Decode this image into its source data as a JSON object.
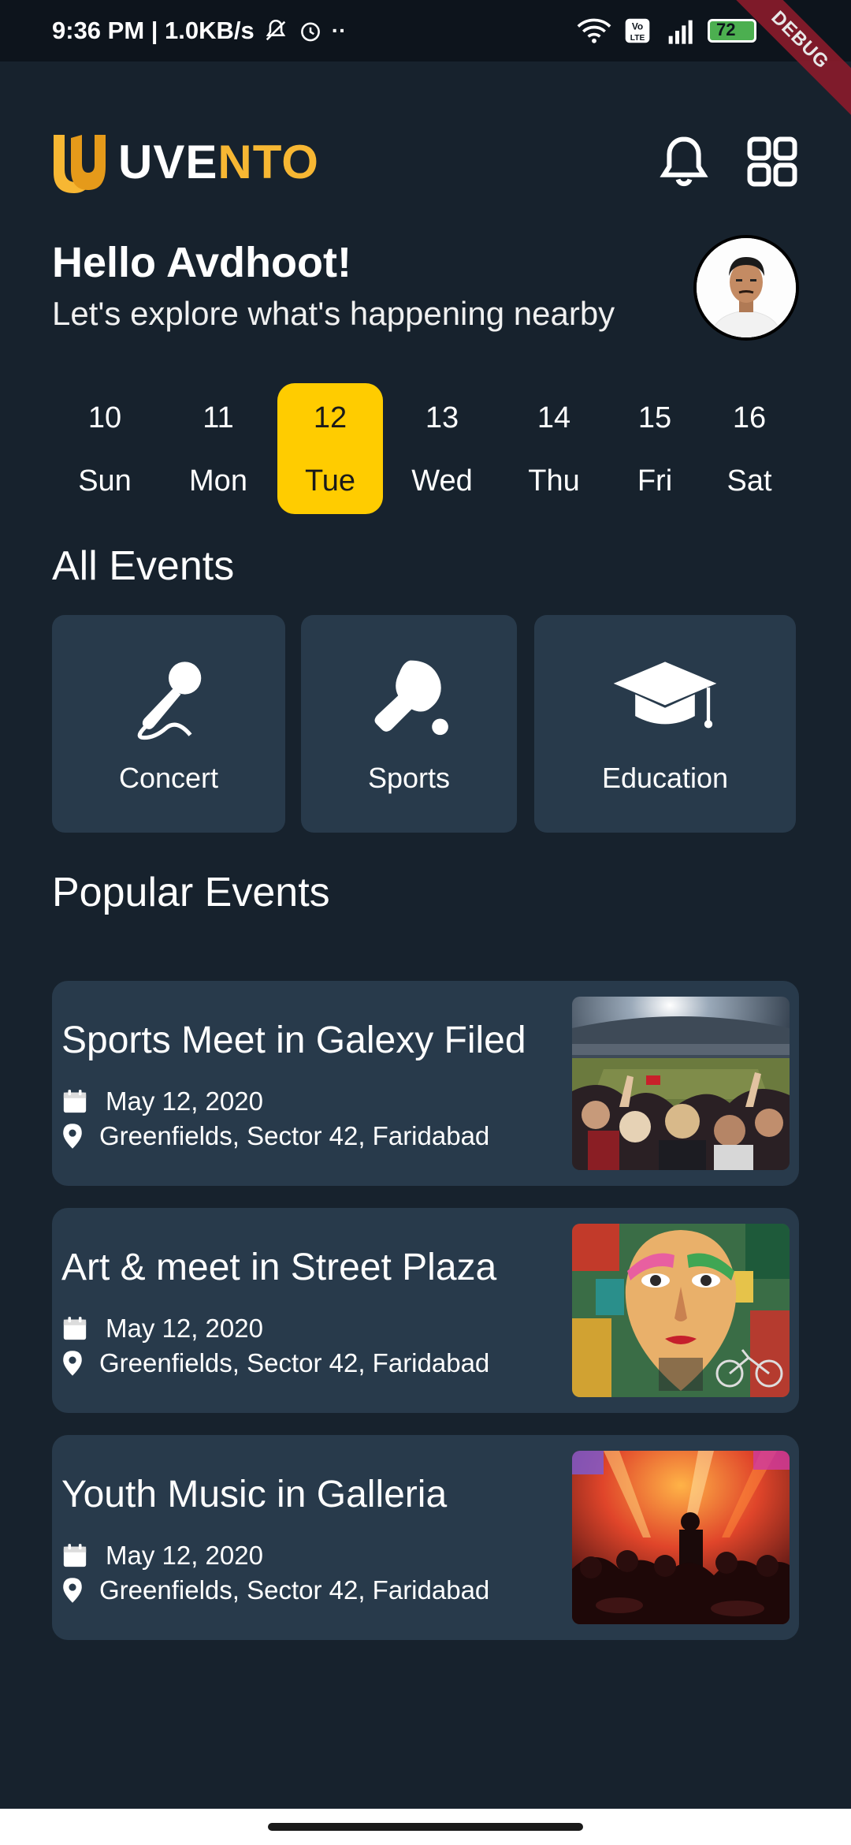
{
  "status_bar": {
    "time_speed": "9:36 PM | 1.0KB/s",
    "battery": "72",
    "debug": "DEBUG"
  },
  "header": {
    "logo_white": "UVE",
    "logo_yellow": "NTO"
  },
  "greeting": {
    "title": "Hello Avdhoot!",
    "subtitle": "Let's explore what's happening nearby"
  },
  "dates": [
    {
      "num": "10",
      "day": "Sun",
      "active": false
    },
    {
      "num": "11",
      "day": "Mon",
      "active": false
    },
    {
      "num": "12",
      "day": "Tue",
      "active": true
    },
    {
      "num": "13",
      "day": "Wed",
      "active": false
    },
    {
      "num": "14",
      "day": "Thu",
      "active": false
    },
    {
      "num": "15",
      "day": "Fri",
      "active": false
    },
    {
      "num": "16",
      "day": "Sat",
      "active": false
    }
  ],
  "sections": {
    "all_events": "All Events",
    "popular_events": "Popular Events"
  },
  "categories": [
    {
      "label": "Concert",
      "icon": "microphone-icon"
    },
    {
      "label": "Sports",
      "icon": "ping-pong-icon"
    },
    {
      "label": "Education",
      "icon": "graduation-cap-icon"
    }
  ],
  "events": [
    {
      "title": "Sports Meet in Galexy Filed",
      "date": "May 12, 2020",
      "location": "Greenfields, Sector 42, Faridabad"
    },
    {
      "title": "Art & meet in Street Plaza",
      "date": "May 12, 2020",
      "location": "Greenfields, Sector 42, Faridabad"
    },
    {
      "title": "Youth Music in Galleria",
      "date": "May 12, 2020",
      "location": "Greenfields, Sector 42, Faridabad"
    }
  ],
  "colors": {
    "background": "#17222d",
    "card": "#283a4b",
    "accent": "#ffcc00",
    "logo_accent": "#f7b733"
  }
}
